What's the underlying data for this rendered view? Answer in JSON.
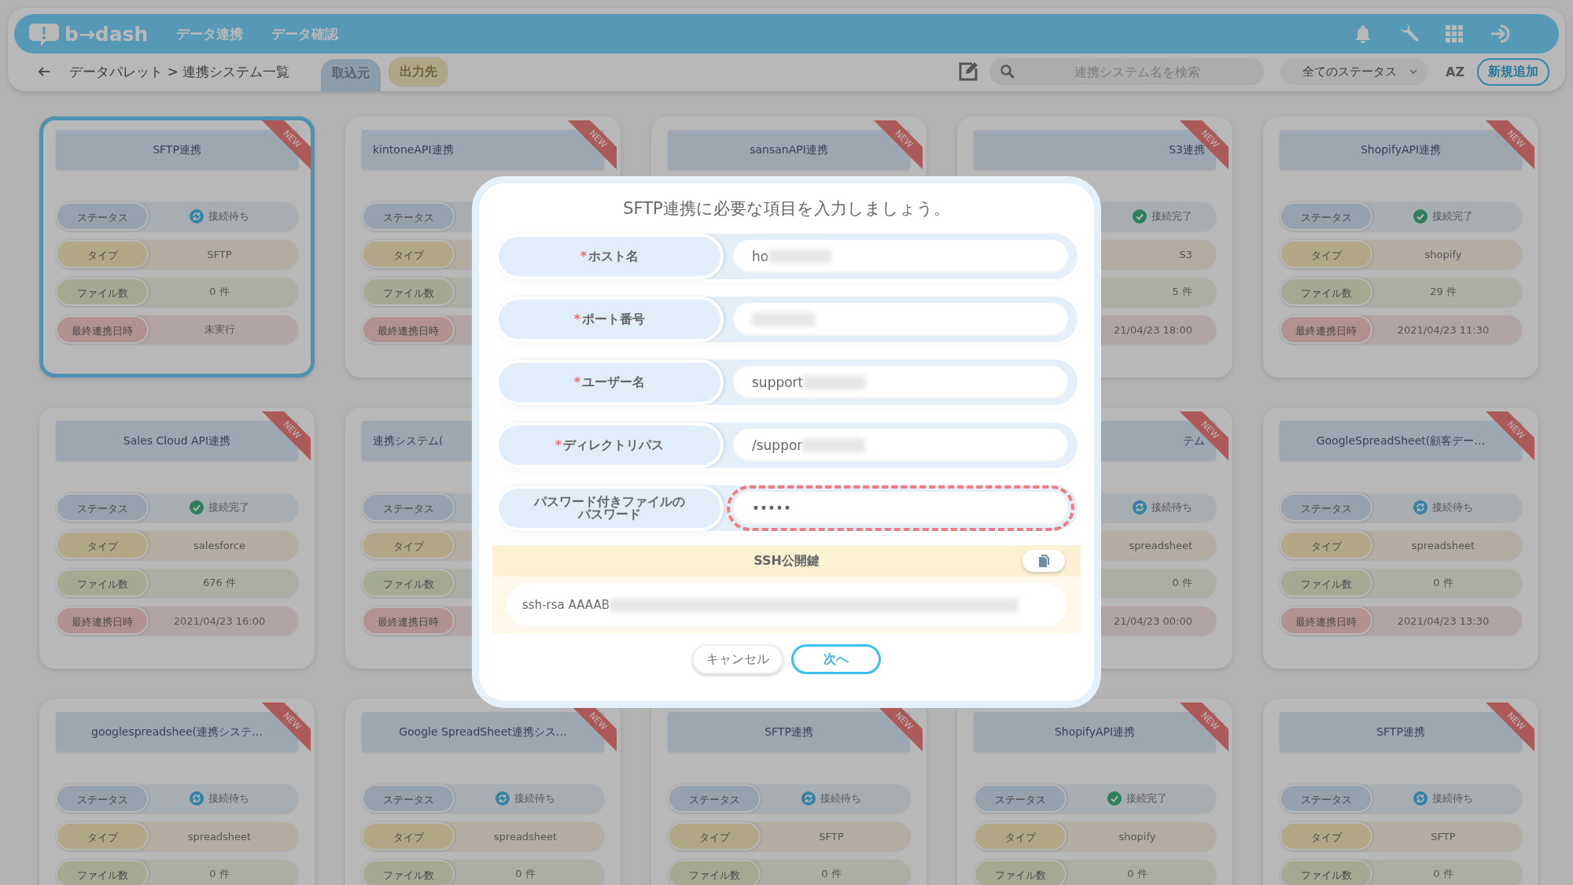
{
  "header": {
    "logo": "b→dash",
    "nav": [
      {
        "label": "データ連携"
      },
      {
        "label": "データ確認"
      }
    ],
    "breadcrumb": "データパレット > 連携システム一覧",
    "tabs": [
      {
        "label": "取込元",
        "selected": true
      },
      {
        "label": "出力先",
        "selected": false
      }
    ],
    "search": {
      "placeholder": "連携システム名を検索"
    },
    "status_filter": "全てのステータス",
    "sort_label": "AZ",
    "add_button": "新規追加"
  },
  "cards": [
    {
      "title": "SFTP連携",
      "badge": "NEW",
      "selected": true,
      "rows": [
        {
          "kind": "status",
          "label": "ステータス",
          "value": "接続待ち",
          "connected": false
        },
        {
          "kind": "type",
          "label": "タイプ",
          "value": "SFTP"
        },
        {
          "kind": "files",
          "label": "ファイル数",
          "value": "0 件"
        },
        {
          "kind": "last",
          "label": "最終連携日時",
          "value": "未実行"
        }
      ]
    },
    {
      "title": "kintoneAPI連携",
      "badge": "NEW",
      "selected": false,
      "rows": [
        {
          "kind": "status",
          "label": "ステータス"
        },
        {
          "kind": "type",
          "label": "タイプ"
        },
        {
          "kind": "files",
          "label": "ファイル数"
        },
        {
          "kind": "last",
          "label": "最終連携日時"
        }
      ]
    },
    {
      "title": "sansanAPI連携",
      "badge": "NEW",
      "selected": false
    },
    {
      "title": "S3連携",
      "badge": "NEW",
      "selected": false,
      "rows": [
        {
          "kind": "status",
          "value": "接続完了",
          "connected": true
        },
        {
          "kind": "type",
          "value": "S3"
        },
        {
          "kind": "files",
          "value": "5 件"
        },
        {
          "kind": "last",
          "value": "21/04/23 18:00"
        }
      ]
    },
    {
      "title": "ShopifyAPI連携",
      "badge": "NEW",
      "selected": false,
      "rows": [
        {
          "kind": "status",
          "label": "ステータス",
          "value": "接続完了",
          "connected": true
        },
        {
          "kind": "type",
          "label": "タイプ",
          "value": "shopify"
        },
        {
          "kind": "files",
          "label": "ファイル数",
          "value": "29 件"
        },
        {
          "kind": "last",
          "label": "最終連携日時",
          "value": "2021/04/23 11:30"
        }
      ]
    },
    {
      "title": "Sales Cloud API連携",
      "badge": "NEW",
      "selected": false,
      "rows": [
        {
          "kind": "status",
          "label": "ステータス",
          "value": "接続完了",
          "connected": true
        },
        {
          "kind": "type",
          "label": "タイプ",
          "value": "salesforce"
        },
        {
          "kind": "files",
          "label": "ファイル数",
          "value": "676 件"
        },
        {
          "kind": "last",
          "label": "最終連携日時",
          "value": "2021/04/23 16:00"
        }
      ]
    },
    {
      "title": "連携システム(",
      "selected": false,
      "rows": [
        {
          "kind": "status",
          "label": "ステータス"
        },
        {
          "kind": "type",
          "label": "タイプ"
        },
        {
          "kind": "files",
          "label": "ファイル数"
        },
        {
          "kind": "last",
          "label": "最終連携日時"
        }
      ]
    },
    {
      "title": "テム",
      "badge": "NEW",
      "selected": false,
      "rows": [
        {
          "kind": "status",
          "value": "接続待ち",
          "connected": false
        },
        {
          "kind": "type",
          "value": "spreadsheet"
        },
        {
          "kind": "files",
          "value": "0 件"
        },
        {
          "kind": "last",
          "value": "21/04/23 00:00"
        }
      ]
    },
    {
      "title": "GoogleSpreadSheet(顧客デー…",
      "badge": "NEW",
      "selected": false,
      "rows": [
        {
          "kind": "status",
          "label": "ステータス",
          "value": "接続待ち",
          "connected": false
        },
        {
          "kind": "type",
          "label": "タイプ",
          "value": "spreadsheet"
        },
        {
          "kind": "files",
          "label": "ファイル数",
          "value": "0 件"
        },
        {
          "kind": "last",
          "label": "最終連携日時",
          "value": "2021/04/23 13:30"
        }
      ]
    },
    {
      "title": "googlespreadshee(連携システ…",
      "badge": "NEW",
      "selected": false,
      "rows": [
        {
          "kind": "status",
          "label": "ステータス",
          "value": "接続待ち",
          "connected": false
        },
        {
          "kind": "type",
          "label": "タイプ",
          "value": "spreadsheet"
        },
        {
          "kind": "files",
          "label": "ファイル数",
          "value": "0 件"
        }
      ]
    },
    {
      "title": "Google SpreadSheet連携シス…",
      "badge": "NEW",
      "selected": false,
      "rows": [
        {
          "kind": "status",
          "label": "ステータス",
          "value": "接続待ち",
          "connected": false
        },
        {
          "kind": "type",
          "label": "タイプ",
          "value": "spreadsheet"
        },
        {
          "kind": "files",
          "label": "ファイル数",
          "value": "0 件"
        }
      ]
    },
    {
      "title": "SFTP連携",
      "badge": "NEW",
      "selected": false,
      "rows": [
        {
          "kind": "status",
          "label": "ステータス",
          "value": "接続待ち",
          "connected": false
        },
        {
          "kind": "type",
          "label": "タイプ",
          "value": "SFTP"
        },
        {
          "kind": "files",
          "label": "ファイル数",
          "value": "0 件"
        }
      ]
    },
    {
      "title": "ShopifyAPI連携",
      "badge": "NEW",
      "selected": false,
      "rows": [
        {
          "kind": "status",
          "label": "ステータス",
          "value": "接続完了",
          "connected": true
        },
        {
          "kind": "type",
          "label": "タイプ",
          "value": "shopify"
        },
        {
          "kind": "files",
          "label": "ファイル数",
          "value": "0 件"
        }
      ]
    },
    {
      "title": "SFTP連携",
      "badge": "NEW",
      "selected": false,
      "rows": [
        {
          "kind": "status",
          "label": "ステータス",
          "value": "接続待ち",
          "connected": false
        },
        {
          "kind": "type",
          "label": "タイプ",
          "value": "SFTP"
        },
        {
          "kind": "files",
          "label": "ファイル数",
          "value": "0 件"
        }
      ]
    }
  ],
  "dialog": {
    "title": "SFTP連携に必要な項目を入力しましょう。",
    "fields": [
      {
        "required_mark": "*",
        "label": "ホスト名",
        "value": "ho",
        "masked": true,
        "highlighted": false
      },
      {
        "required_mark": "*",
        "label": "ポート番号",
        "masked": true,
        "highlighted": false
      },
      {
        "required_mark": "*",
        "label": "ユーザー名",
        "value": "support",
        "masked": true,
        "highlighted": false
      },
      {
        "required_mark": "*",
        "label": "ディレクトリパス",
        "value": "/suppor",
        "masked": true,
        "highlighted": false
      },
      {
        "label": "パスワード付きファイルのパスワード",
        "value": "•••••",
        "masked": false,
        "highlighted": true
      }
    ],
    "ssh": {
      "title": "SSH公開鍵",
      "key": "ssh-rsa AAAAB",
      "masked": true
    },
    "buttons": [
      {
        "label": "キャンセル",
        "kind": "secondary"
      },
      {
        "label": "次へ",
        "kind": "primary"
      }
    ]
  }
}
